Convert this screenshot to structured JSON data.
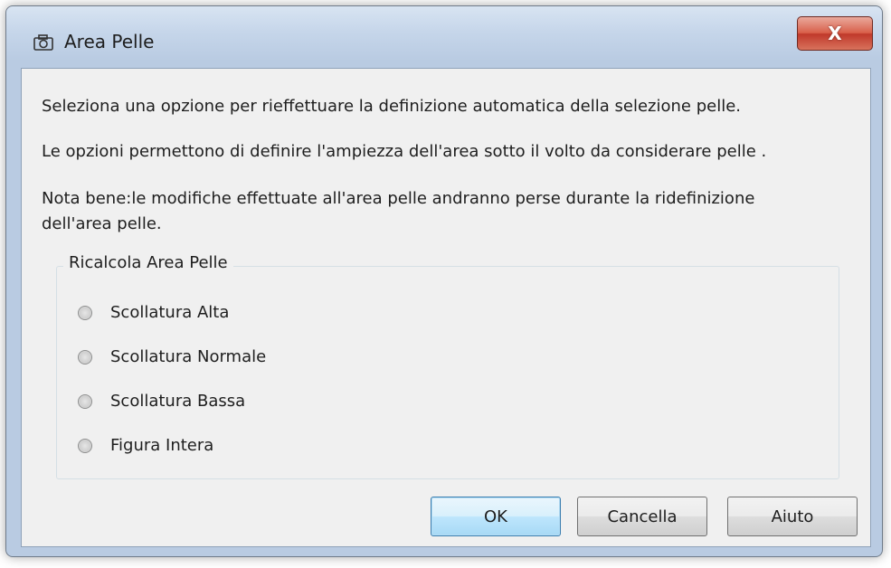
{
  "window": {
    "title": "Area Pelle",
    "close_label": "X"
  },
  "body": {
    "line1": "Seleziona una opzione per rieffettuare la definizione automatica della selezione pelle.",
    "line2": "Le opzioni permettono di definire l'ampiezza dell'area sotto il volto da considerare pelle .",
    "line3a": "Nota bene:le modifiche effettuate all'area pelle andranno perse durante la ridefinizione",
    "line3b": "dell'area pelle."
  },
  "group": {
    "legend": "Ricalcola Area Pelle",
    "options": [
      {
        "label": "Scollatura Alta",
        "selected": false
      },
      {
        "label": "Scollatura Normale",
        "selected": false
      },
      {
        "label": "Scollatura Bassa",
        "selected": false
      },
      {
        "label": "Figura Intera",
        "selected": false
      }
    ]
  },
  "buttons": {
    "ok": "OK",
    "cancel": "Cancella",
    "help": "Aiuto"
  },
  "icons": {
    "title_icon": "camera-icon",
    "close_icon": "close-icon"
  },
  "colors": {
    "close_button": "#d9604b",
    "default_button_border": "#3c7fb1",
    "client_background": "#f0f0f0"
  }
}
